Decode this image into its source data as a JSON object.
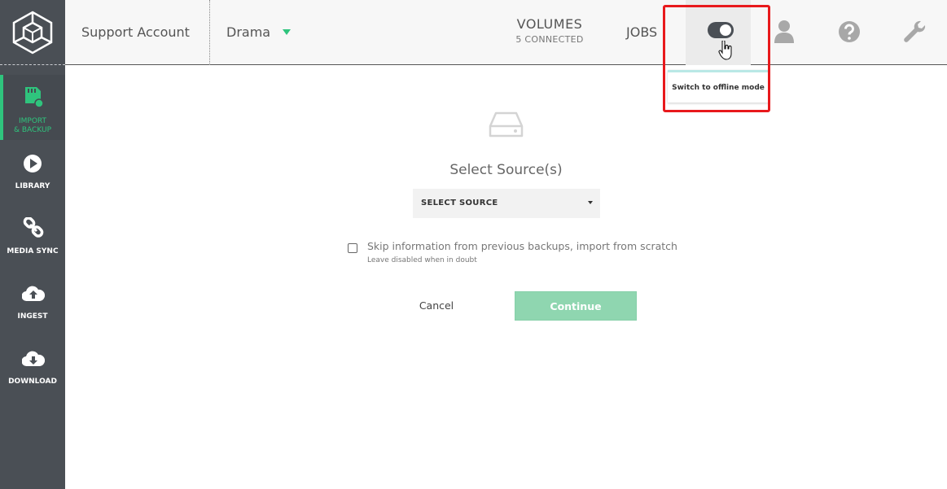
{
  "sidebar": {
    "items": [
      {
        "label_line1": "IMPORT",
        "label_line2": "& BACKUP",
        "icon": "sd-card-icon"
      },
      {
        "label": "LIBRARY",
        "icon": "play-circle-icon"
      },
      {
        "label": "MEDIA SYNC",
        "icon": "link-icon"
      },
      {
        "label": "INGEST",
        "icon": "cloud-upload-icon"
      },
      {
        "label": "DOWNLOAD",
        "icon": "cloud-download-icon"
      }
    ]
  },
  "header": {
    "account": "Support Account",
    "project": "Drama",
    "volumes_title": "VOLUMES",
    "volumes_subtitle": "5 CONNECTED",
    "jobs": "JOBS"
  },
  "tooltip": {
    "text": "Switch to offline mode"
  },
  "main": {
    "title": "Select Source(s)",
    "select_placeholder": "SELECT SOURCE",
    "skip_label": "Skip information from previous backups, import from scratch",
    "skip_hint": "Leave disabled when in doubt",
    "cancel_label": "Cancel",
    "continue_label": "Continue"
  },
  "colors": {
    "accent": "#2fc47d",
    "sidebar_bg": "#4a4f55",
    "continue_bg": "#8fd6b0",
    "highlight": "#e8191c"
  }
}
